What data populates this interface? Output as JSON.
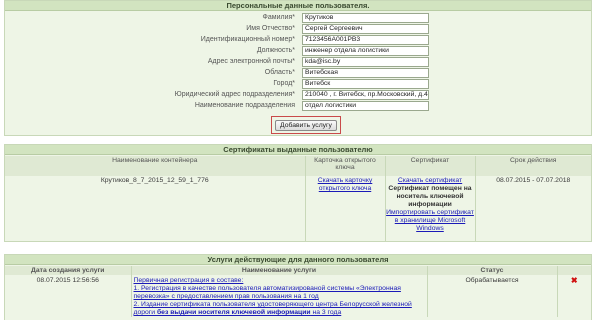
{
  "personal": {
    "title": "Персональные данные пользователя.",
    "fields": [
      {
        "label": "Фамилия*",
        "value": "Крутиков"
      },
      {
        "label": "Имя Отчество*",
        "value": "Сергей Сергеевич"
      },
      {
        "label": "Идентификационный номер*",
        "value": "7123456A001PB3"
      },
      {
        "label": "Должность*",
        "value": "инженер отдела логистики"
      },
      {
        "label": "Адрес электронной почты*",
        "value": "kda@isc.by"
      },
      {
        "label": "Область*",
        "value": "Витебская"
      },
      {
        "label": "Город*",
        "value": "Витебск"
      },
      {
        "label": "Юридический адрес подразделения*",
        "value": "210040 , г. Витебск, пр.Московский, д.45"
      },
      {
        "label": "Наименование подразделения",
        "value": "отдел логистики"
      }
    ],
    "add_button": "Добавить услугу"
  },
  "certs": {
    "title": "Сертификаты выданные пользователю",
    "headers": [
      "Наименование контейнера",
      "Карточка открытого ключа",
      "Сертификат",
      "Срок действия"
    ],
    "row": {
      "container": "Крутиков_8_7_2015_12_59_1_776",
      "card_link": "Скачать карточку открытого ключа",
      "cert_link": "Скачать сертификат",
      "cert_note": "Сертификат помещен на носитель ключевой информации",
      "import_link": "Импортировать сертификат в хранилище Microsoft Windows",
      "validity": "08.07.2015 - 07.07.2018"
    }
  },
  "services": {
    "title": "Услуги действующие для данного пользователя",
    "headers": [
      "Дата создания услуги",
      "Наименование услуги",
      "Статус"
    ],
    "row": {
      "date": "08.07.2015 12:56:56",
      "line1": "Первичная регистрация в составе:",
      "line2": "1. Регистрация в качестве пользователя автоматизированой системы «Электронная",
      "line3": "перевозка» с предоставлением прав пользования на 1 год",
      "line4": "2. Издание сертификата пользователя удостоверяющего центра Белорусской железной",
      "line5a": "дороги ",
      "line5b": "без выдачи носителя ключевой информации",
      "line5c": " на 3 года",
      "status": "Обрабатывается"
    }
  }
}
